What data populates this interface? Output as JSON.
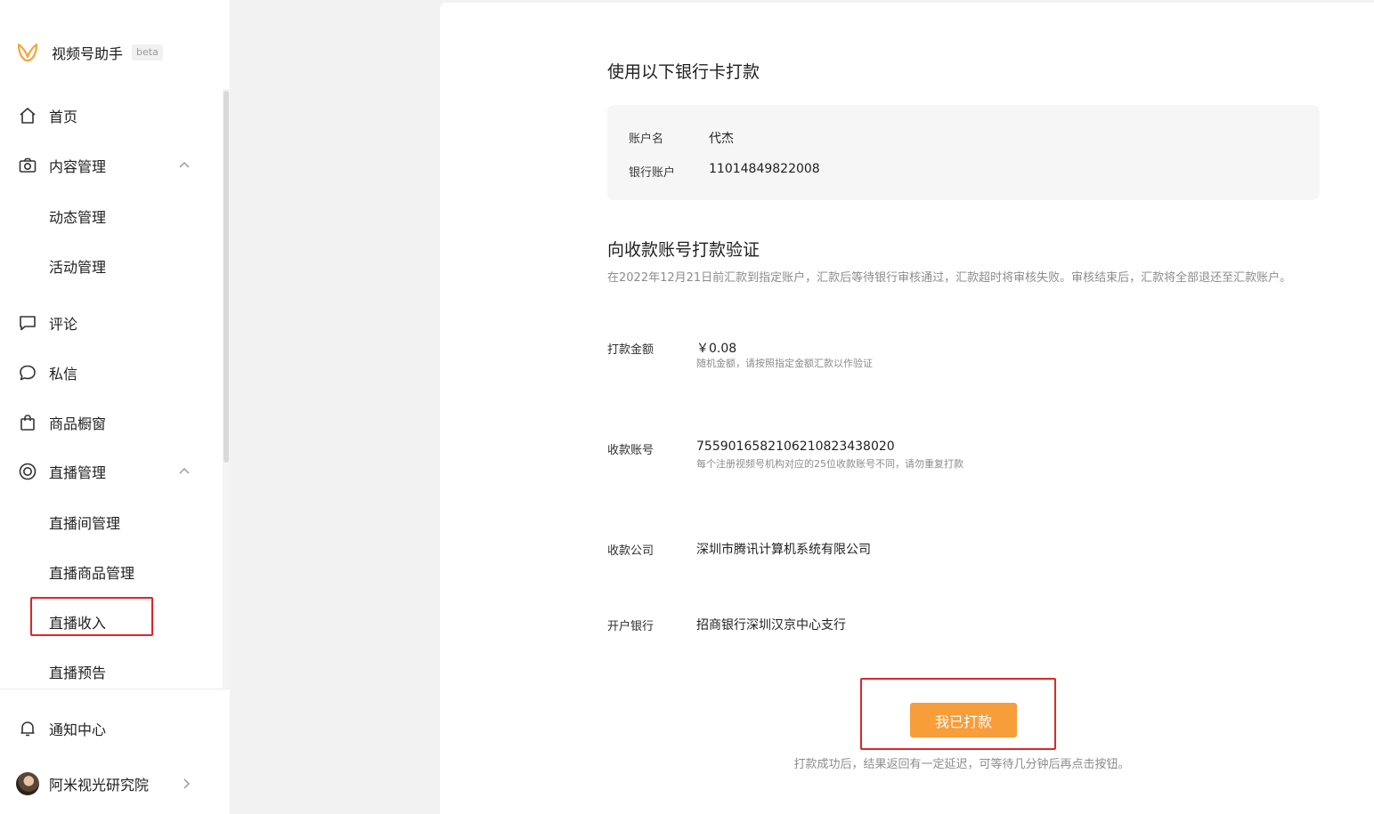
{
  "app": {
    "name": "视频号助手",
    "badge": "beta"
  },
  "sidebar": {
    "items": [
      {
        "label": "首页",
        "icon": "home-icon"
      },
      {
        "label": "内容管理",
        "icon": "camera-icon",
        "expanded": true,
        "children": [
          "动态管理",
          "活动管理"
        ]
      },
      {
        "label": "评论",
        "icon": "comment-icon"
      },
      {
        "label": "私信",
        "icon": "message-icon"
      },
      {
        "label": "商品橱窗",
        "icon": "shopping-bag-icon"
      },
      {
        "label": "直播管理",
        "icon": "live-icon",
        "expanded": true,
        "children": [
          "直播间管理",
          "直播商品管理",
          "直播收入",
          "直播预告"
        ]
      }
    ],
    "active_child": "直播收入",
    "notification": {
      "label": "通知中心",
      "icon": "bell-icon"
    },
    "user": {
      "name": "阿米视光研究院"
    }
  },
  "bank_card": {
    "title": "使用以下银行卡打款",
    "account_name_label": "账户名",
    "account_name": "代杰",
    "account_number_label": "银行账户",
    "account_number": "11014849822008"
  },
  "verify": {
    "title": "向收款账号打款验证",
    "description": "在2022年12月21日前汇款到指定账户，汇款后等待银行审核通过，汇款超时将审核失败。审核结束后，汇款将全部退还至汇款账户。",
    "rows": [
      {
        "label": "打款金额",
        "value": "￥0.08",
        "hint": "随机金额，请按照指定金额汇款以作验证"
      },
      {
        "label": "收款账号",
        "value": "755901658210621082343802​0",
        "hint": "每个注册视频号机构对应的25位收款账号不同，请勿重复打款"
      },
      {
        "label": "收款公司",
        "value": "深圳市腾讯计算机系统有限公司"
      },
      {
        "label": "开户银行",
        "value": "招商银行深圳汉京中心支行"
      }
    ],
    "button_label": "我已打款",
    "footnote": "打款成功后，结果返回有一定延迟，可等待几分钟后再点击按钮。"
  },
  "colors": {
    "accent": "#f79d3a",
    "highlight_box": "#e12525",
    "logo": "#f5a43b"
  }
}
